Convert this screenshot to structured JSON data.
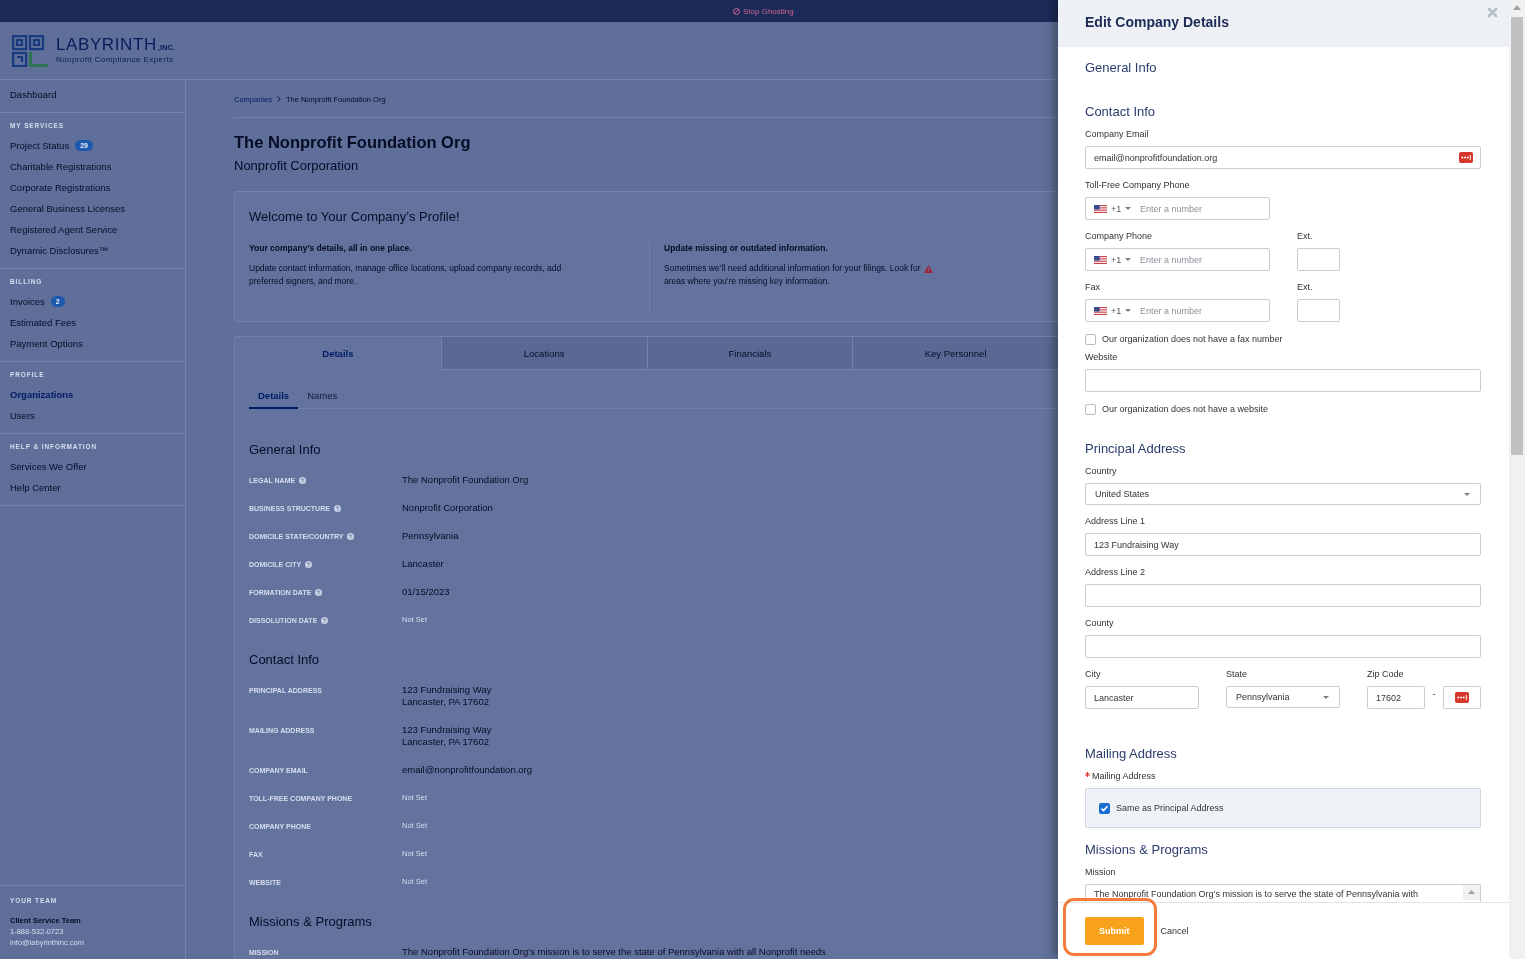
{
  "top_bar": {
    "notice": "Stop Ghosting"
  },
  "header": {
    "logo": {
      "name": "LABYRINTH",
      "suffix": ",INC.",
      "tagline": "Nonprofit Compliance Experts"
    }
  },
  "sidebar": {
    "sections": [
      {
        "items": [
          {
            "label": "Dashboard",
            "selected": false
          }
        ]
      },
      {
        "heading": "MY SERVICES",
        "items": [
          {
            "label": "Project Status",
            "badge": "29",
            "selected": false
          },
          {
            "label": "Charitable Registrations",
            "selected": false
          },
          {
            "label": "Corporate Registrations",
            "selected": false
          },
          {
            "label": "General Business Licenses",
            "selected": false
          },
          {
            "label": "Registered Agent Service",
            "selected": false
          },
          {
            "label": "Dynamic Disclosures™",
            "selected": false
          }
        ]
      },
      {
        "heading": "BILLING",
        "items": [
          {
            "label": "Invoices",
            "badge": "2",
            "selected": false
          },
          {
            "label": "Estimated Fees",
            "selected": false
          },
          {
            "label": "Payment Options",
            "selected": false
          }
        ]
      },
      {
        "heading": "PROFILE",
        "items": [
          {
            "label": "Organizations",
            "selected": true
          },
          {
            "label": "Users",
            "selected": false
          }
        ]
      },
      {
        "heading": "HELP & INFORMATION",
        "items": [
          {
            "label": "Services We Offer",
            "selected": false
          },
          {
            "label": "Help Center",
            "selected": false
          }
        ]
      }
    ],
    "team": {
      "heading": "YOUR TEAM",
      "name": "Client Service Team",
      "phone": "1-888-532-0723",
      "email": "info@labyrinthinc.com"
    }
  },
  "breadcrumb": [
    {
      "label": "Companies",
      "kind": "link"
    },
    {
      "label": "The Nonprofit Foundation Org",
      "kind": "current"
    }
  ],
  "company": {
    "name": "The Nonprofit Foundation Org",
    "type": "Nonprofit Corporation"
  },
  "welcome": {
    "title": "Welcome to Your Company’s Profile!",
    "left": {
      "heading": "Your company’s details, all in one place.",
      "text": "Update contact information, manage office locations, upload company records, add preferred signers, and more."
    },
    "right": {
      "heading": "Update missing or outdated information.",
      "text": "Sometimes we’ll need additional information for your filings. Look for",
      "text_after_icon": "areas where you’re missing key information."
    }
  },
  "tabs": [
    {
      "label": "Details",
      "selected": true
    },
    {
      "label": "Locations",
      "selected": false
    },
    {
      "label": "Financials",
      "selected": false
    },
    {
      "label": "Key Personnel",
      "selected": false
    }
  ],
  "subtabs": [
    {
      "label": "Details",
      "selected": true
    },
    {
      "label": "Names",
      "selected": false
    }
  ],
  "details": {
    "sections": [
      {
        "title": "General Info",
        "rows": [
          {
            "label": "LEGAL NAME",
            "help": true,
            "value": [
              "The Nonprofit Foundation Org"
            ],
            "set": true
          },
          {
            "label": "BUSINESS STRUCTURE",
            "help": true,
            "value": [
              "Nonprofit Corporation"
            ],
            "set": true
          },
          {
            "label": "DOMICILE STATE/COUNTRY",
            "help": true,
            "value": [
              "Pennsylvania"
            ],
            "set": true
          },
          {
            "label": "DOMICILE CITY",
            "help": true,
            "value": [
              "Lancaster"
            ],
            "set": true
          },
          {
            "label": "FORMATION DATE",
            "help": true,
            "value": [
              "01/15/2023"
            ],
            "set": true
          },
          {
            "label": "DISSOLUTION DATE",
            "help": true,
            "value": [
              "Not Set"
            ],
            "set": false
          }
        ]
      },
      {
        "title": "Contact Info",
        "rows": [
          {
            "label": "PRINCIPAL ADDRESS",
            "help": false,
            "value": [
              "123 Fundraising Way",
              "Lancaster, PA 17602"
            ],
            "set": true
          },
          {
            "label": "MAILING ADDRESS",
            "help": false,
            "value": [
              "123 Fundraising Way",
              "Lancaster, PA 17602"
            ],
            "set": true
          },
          {
            "label": "COMPANY EMAIL",
            "help": false,
            "value": [
              "email@nonprofitfoundation.org"
            ],
            "set": true
          },
          {
            "label": "TOLL-FREE COMPANY PHONE",
            "help": false,
            "value": [
              "Not Set"
            ],
            "set": false
          },
          {
            "label": "COMPANY PHONE",
            "help": false,
            "value": [
              "Not Set"
            ],
            "set": false
          },
          {
            "label": "FAX",
            "help": false,
            "value": [
              "Not Set"
            ],
            "set": false
          },
          {
            "label": "WEBSITE",
            "help": false,
            "value": [
              "Not Set"
            ],
            "set": false
          }
        ]
      },
      {
        "title": "Missions & Programs",
        "rows": [
          {
            "label": "MISSION",
            "help": false,
            "value": [
              "The Nonprofit Foundation Org’s mission is to serve the state of Pennsylvania with all Nonprofit needs"
            ],
            "set": true
          }
        ]
      }
    ]
  },
  "edit_panel": {
    "title": "Edit Company Details",
    "sections": [
      {
        "title": "General Info"
      },
      {
        "title": "Contact Info",
        "fields": [
          {
            "kind": "text",
            "label": "Company Email",
            "value": "email@nonprofitfoundation.org",
            "autofill": true
          },
          {
            "kind": "phone",
            "label": "Toll-Free Company Phone",
            "code": "+1",
            "placeholder": "Enter a number"
          },
          {
            "kind": "phone",
            "label": "Company Phone",
            "code": "+1",
            "placeholder": "Enter a number",
            "ext": {
              "label": "Ext."
            }
          },
          {
            "kind": "phone",
            "label": "Fax",
            "code": "+1",
            "placeholder": "Enter a number",
            "ext": {
              "label": "Ext."
            }
          },
          {
            "kind": "checkbox",
            "label": "Our organization does not have a fax number",
            "checked": false
          },
          {
            "kind": "text",
            "label": "Website",
            "autofill": false
          },
          {
            "kind": "checkbox",
            "label": "Our organization does not have a website",
            "checked": false
          }
        ]
      },
      {
        "title": "Principal Address",
        "fields": [
          {
            "kind": "select",
            "label": "Country",
            "value": "United States"
          },
          {
            "kind": "text",
            "label": "Address Line 1",
            "value": "123 Fundraising Way",
            "autofill": false
          },
          {
            "kind": "text",
            "label": "Address Line 2",
            "autofill": false
          },
          {
            "kind": "text",
            "label": "County",
            "autofill": false
          },
          {
            "kind": "city_state_zip",
            "city": {
              "label": "City",
              "value": "Lancaster"
            },
            "state": {
              "label": "State",
              "value": "Pennsylvania"
            },
            "zip": {
              "label": "Zip Code",
              "value": "17602",
              "separator": "-",
              "extension_autofill": true
            }
          }
        ]
      },
      {
        "title": "Mailing Address",
        "fields": [
          {
            "kind": "option_box",
            "label": "Mailing Address",
            "required": true,
            "option": {
              "label": "Same as Principal Address",
              "checked": true
            }
          }
        ]
      },
      {
        "title": "Missions & Programs",
        "fields": [
          {
            "kind": "textarea",
            "label": "Mission",
            "value": "The Nonprofit Foundation Org’s mission is to serve the state of Pennsylvania with"
          }
        ]
      }
    ],
    "actions": [
      {
        "label": "Submit",
        "kind": "primary",
        "highlighted": true
      },
      {
        "label": "Cancel",
        "kind": "link",
        "highlighted": false
      }
    ]
  }
}
